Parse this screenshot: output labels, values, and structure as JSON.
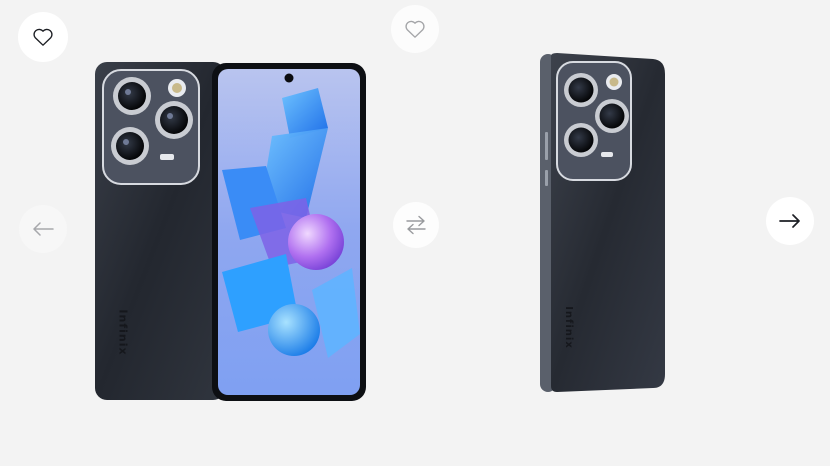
{
  "gallery": {
    "products": [
      {
        "brand": "Infinix"
      },
      {
        "brand": "Infinix"
      }
    ]
  },
  "icons": {
    "favorite": "heart-icon",
    "compare": "swap-arrows-icon",
    "previous": "arrow-left-icon",
    "next": "arrow-right-icon"
  },
  "colors": {
    "background": "#f3f3f3",
    "phone_body": "#2b3039",
    "button_bg": "#ffffff"
  }
}
